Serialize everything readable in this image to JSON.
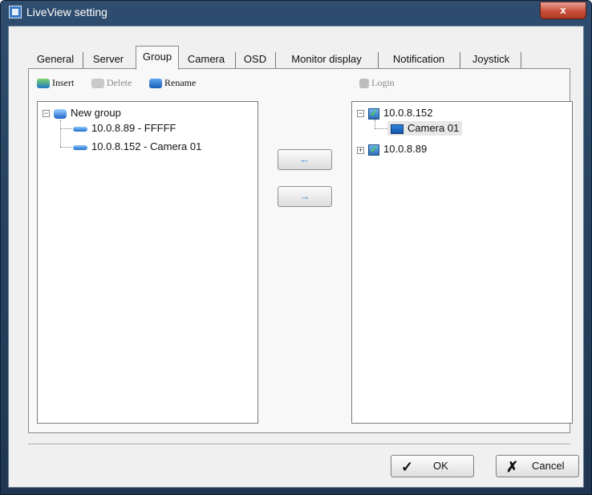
{
  "window": {
    "title": "LiveView setting",
    "close_label": "x",
    "app_icon": "liveview-app-icon",
    "accent_color": "#2a4868"
  },
  "tabs": [
    {
      "label": "General",
      "active": false
    },
    {
      "label": "Server",
      "active": false
    },
    {
      "label": "Group",
      "active": true
    },
    {
      "label": "Camera",
      "active": false
    },
    {
      "label": "OSD",
      "active": false
    },
    {
      "label": "Monitor display",
      "active": false
    },
    {
      "label": "Notification",
      "active": false
    },
    {
      "label": "Joystick",
      "active": false
    }
  ],
  "group_toolbar": {
    "insert_label": "Insert",
    "delete_label": "Delete",
    "rename_label": "Rename"
  },
  "camera_toolbar": {
    "login_label": "Login"
  },
  "group_tree": {
    "root": {
      "label": "New group",
      "expanded": true
    },
    "children": [
      {
        "label": "10.0.8.89 - FFFFF"
      },
      {
        "label": "10.0.8.152 - Camera 01"
      }
    ]
  },
  "camera_tree": {
    "servers": [
      {
        "label": "10.0.8.152",
        "expanded": true,
        "children": [
          {
            "label": "Camera 01",
            "selected": true
          }
        ]
      },
      {
        "label": "10.0.8.89",
        "expanded": false,
        "children": []
      }
    ]
  },
  "transfer": {
    "left_arrow": "←",
    "right_arrow": "→"
  },
  "buttons": {
    "ok_label": "OK",
    "ok_mark": "✓",
    "cancel_label": "Cancel",
    "cancel_mark": "✗"
  }
}
